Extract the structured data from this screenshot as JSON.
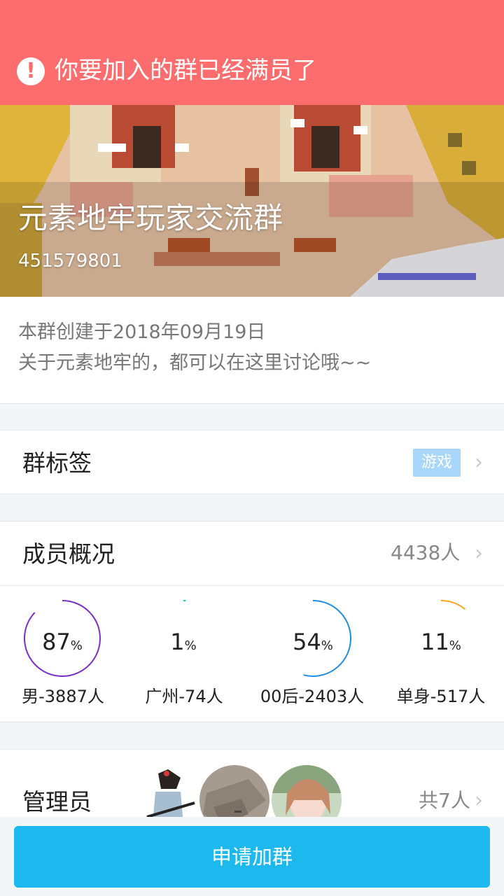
{
  "alert": {
    "icon": "exclamation-circle-icon",
    "text": "你要加入的群已经满员了"
  },
  "group": {
    "name": "元素地牢玩家交流群",
    "id": "451579801",
    "created": "本群创建于2018年09月19日",
    "intro": "关于元素地牢的，都可以在这里讨论哦~~"
  },
  "tags_row": {
    "title": "群标签",
    "tag": "游戏"
  },
  "members_row": {
    "title": "成员概况",
    "count": "4438人"
  },
  "stats": [
    {
      "value": "87",
      "unit": "%",
      "label": "男-3887人",
      "ring_fraction": 0.87,
      "color": "#7b2fc9"
    },
    {
      "value": "1",
      "unit": "%",
      "label": "广州-74人",
      "ring_fraction": 0.01,
      "color": "#2bc2a6"
    },
    {
      "value": "54",
      "unit": "%",
      "label": "00后-2403人",
      "ring_fraction": 0.54,
      "color": "#1f8fe0"
    },
    {
      "value": "11",
      "unit": "%",
      "label": "单身-517人",
      "ring_fraction": 0.11,
      "color": "#f5a623"
    }
  ],
  "admins_row": {
    "title": "管理员",
    "count": "共7人"
  },
  "apply_button": "申请加群",
  "colors": {
    "alert": "#fe6d6d",
    "button": "#1cb8ee",
    "tag": "#a9d6fb"
  }
}
